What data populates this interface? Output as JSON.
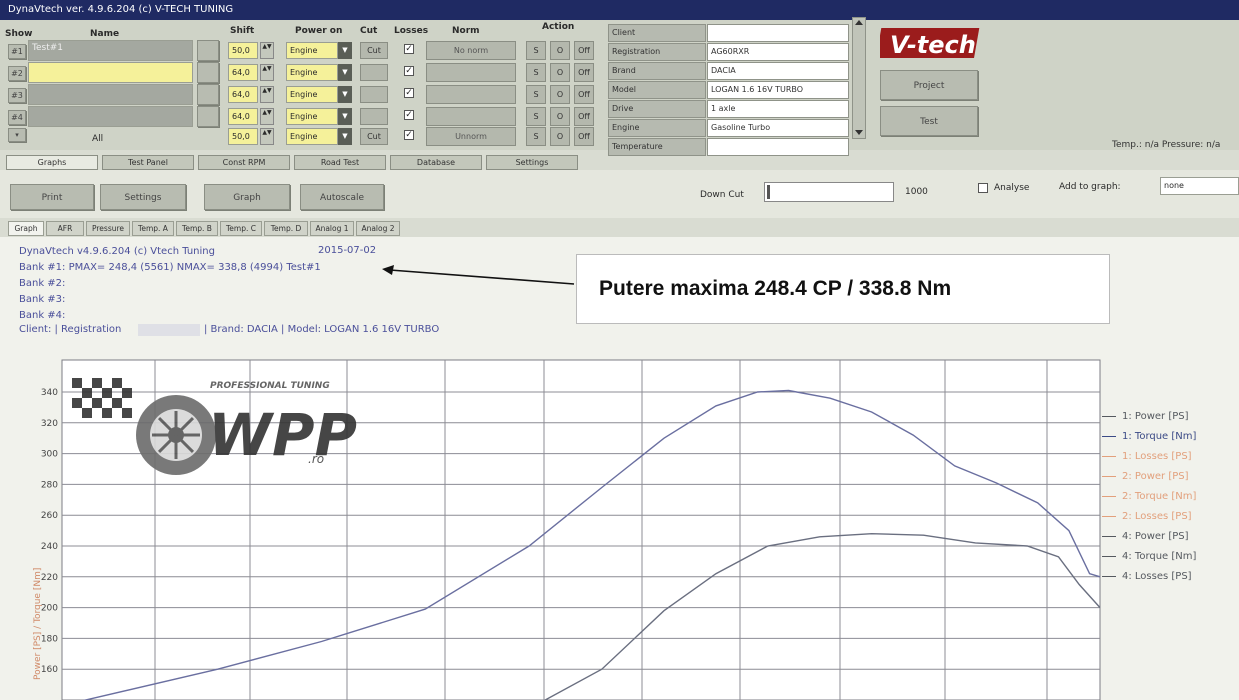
{
  "window": {
    "title": "DynaVtech ver. 4.9.6.204 (c) V-TECH TUNING"
  },
  "columns": {
    "show": "Show",
    "name": "Name",
    "shift": "Shift",
    "power_on": "Power on",
    "cut": "Cut",
    "losses": "Losses",
    "norm": "Norm",
    "action": "Action"
  },
  "runs": [
    {
      "id": "#1",
      "name": "Test#1",
      "shift": "50,0",
      "power_on": "Engine",
      "cut": "Cut",
      "norm": "No norm"
    },
    {
      "id": "#2",
      "name": "",
      "shift": "64,0",
      "power_on": "Engine",
      "cut": "",
      "norm": ""
    },
    {
      "id": "#3",
      "name": "",
      "shift": "64,0",
      "power_on": "Engine",
      "cut": "",
      "norm": ""
    },
    {
      "id": "#4",
      "name": "",
      "shift": "64,0",
      "power_on": "Engine",
      "cut": "",
      "norm": ""
    },
    {
      "id": "",
      "name": "All",
      "shift": "50,0",
      "power_on": "Engine",
      "cut": "Cut",
      "norm": "Unnorm"
    }
  ],
  "action_buttons": [
    "S",
    "O",
    "Off"
  ],
  "client_fields": [
    {
      "label": "Client",
      "value": ""
    },
    {
      "label": "Registration",
      "value": "AG60RXR"
    },
    {
      "label": "Brand",
      "value": "DACIA"
    },
    {
      "label": "Model",
      "value": "LOGAN 1.6 16V TURBO"
    },
    {
      "label": "Drive",
      "value": "1 axle"
    },
    {
      "label": "Engine",
      "value": "Gasoline Turbo"
    },
    {
      "label": "Temperature",
      "value": ""
    }
  ],
  "logo": {
    "text": "V-tech"
  },
  "right_buttons": {
    "project": "Project",
    "test": "Test"
  },
  "status": {
    "text": "Temp.: n/a   Pressure: n/a"
  },
  "main_tabs": [
    "Graphs",
    "Test Panel",
    "Const RPM",
    "Road Test",
    "Database",
    "Settings"
  ],
  "toolbar": {
    "print": "Print",
    "settings": "Settings",
    "graph": "Graph",
    "autoscale": "Autoscale",
    "down_cut_label": "Down Cut",
    "down_cut_value": "1000",
    "analyse": "Analyse",
    "add_to_graph_label": "Add to graph:",
    "add_to_graph_value": "none"
  },
  "sub_tabs": [
    "Graph",
    "AFR",
    "Pressure",
    "Temp. A",
    "Temp. B",
    "Temp. C",
    "Temp. D",
    "Analog 1",
    "Analog 2"
  ],
  "info": {
    "line1_left": "DynaVtech v4.9.6.204 (c) Vtech Tuning",
    "line1_right": "2015-07-02",
    "bank1": "Bank #1:  PMAX= 248,4 (5561)     NMAX= 338,8 (4994)   Test#1",
    "bank2": "Bank #2:",
    "bank3": "Bank #3:",
    "bank4": "Bank #4:",
    "client_prefix": "Client:  | Registration",
    "client_suffix": "| Brand: DACIA | Model: LOGAN 1.6 16V TURBO"
  },
  "annotation": {
    "text": "Putere maxima  248.4 CP   /  338.8 Nm"
  },
  "watermark": {
    "brand": "WPP",
    "domain": ".ro",
    "tagline": "PROFESSIONAL TUNING"
  },
  "chart_data": {
    "type": "line",
    "ylabel": "Power [PS] / Torque [Nm]",
    "y_ticks": [
      160,
      180,
      200,
      220,
      240,
      260,
      280,
      300,
      320,
      340
    ],
    "ylim": [
      140,
      350
    ],
    "grid": true,
    "legend_position": "right",
    "legend": [
      {
        "name": "1: Power [PS]",
        "color": "#55595f"
      },
      {
        "name": "1: Torque [Nm]",
        "color": "#3b4a86"
      },
      {
        "name": "1: Losses [PS]",
        "color": "#e2a07c"
      },
      {
        "name": "2: Power [PS]",
        "color": "#e2a07c"
      },
      {
        "name": "2: Torque [Nm]",
        "color": "#e2a07c"
      },
      {
        "name": "2: Losses [PS]",
        "color": "#e2a07c"
      },
      {
        "name": "4: Power [PS]",
        "color": "#55595f"
      },
      {
        "name": "4: Torque [Nm]",
        "color": "#55595f"
      },
      {
        "name": "4: Losses [PS]",
        "color": "#55595f"
      }
    ],
    "series": [
      {
        "name": "1: Torque [Nm]",
        "color": "#6a6fa0",
        "points": [
          [
            0.1,
            138
          ],
          [
            1.5,
            160
          ],
          [
            2.5,
            178
          ],
          [
            3.5,
            199
          ],
          [
            4.5,
            240
          ],
          [
            5.2,
            278
          ],
          [
            5.8,
            310
          ],
          [
            6.3,
            331
          ],
          [
            6.7,
            340
          ],
          [
            7.0,
            341
          ],
          [
            7.4,
            336
          ],
          [
            7.8,
            327
          ],
          [
            8.2,
            312
          ],
          [
            8.6,
            292
          ],
          [
            9.0,
            281
          ],
          [
            9.4,
            268
          ],
          [
            9.7,
            250
          ],
          [
            9.9,
            222
          ],
          [
            10.0,
            220
          ]
        ]
      },
      {
        "name": "1: Power [PS]",
        "color": "#6a6f80",
        "points": [
          [
            4.6,
            138
          ],
          [
            5.2,
            160
          ],
          [
            5.8,
            198
          ],
          [
            6.3,
            222
          ],
          [
            6.8,
            240
          ],
          [
            7.3,
            246
          ],
          [
            7.8,
            248
          ],
          [
            8.3,
            247
          ],
          [
            8.8,
            242
          ],
          [
            9.3,
            240
          ],
          [
            9.6,
            233
          ],
          [
            9.8,
            215
          ],
          [
            10.0,
            200
          ]
        ]
      }
    ]
  }
}
